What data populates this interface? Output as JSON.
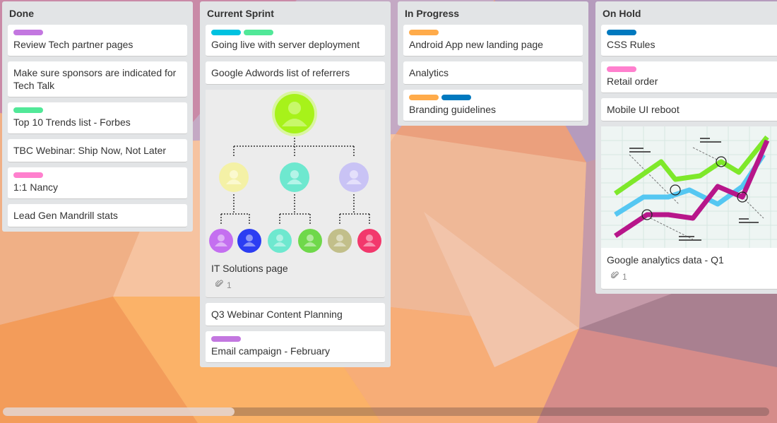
{
  "lists": [
    {
      "title": "Done",
      "cards": [
        {
          "title": "Review Tech partner pages",
          "labels": [
            "#c377e0"
          ]
        },
        {
          "title": "Make sure sponsors are indicated for Tech Talk",
          "labels": []
        },
        {
          "title": "Top 10 Trends list - Forbes",
          "labels": [
            "#51e898"
          ]
        },
        {
          "title": "TBC Webinar: Ship Now, Not Later",
          "labels": []
        },
        {
          "title": "1:1 Nancy",
          "labels": [
            "#ff80ce"
          ]
        },
        {
          "title": "Lead Gen Mandrill stats",
          "labels": []
        }
      ]
    },
    {
      "title": "Current Sprint",
      "cards": [
        {
          "title": "Going live with server deployment",
          "labels": [
            "#00c2e0",
            "#51e898"
          ]
        },
        {
          "title": "Google Adwords list of referrers",
          "labels": []
        },
        {
          "title": "IT Solutions page",
          "labels": [],
          "attachments": "1"
        },
        {
          "title": "Q3 Webinar Content Planning",
          "labels": []
        },
        {
          "title": "Email campaign - February",
          "labels": [
            "#c377e0"
          ]
        }
      ]
    },
    {
      "title": "In Progress",
      "cards": [
        {
          "title": "Android App new landing page",
          "labels": [
            "#ffab4a"
          ]
        },
        {
          "title": "Analytics",
          "labels": []
        },
        {
          "title": "Branding guidelines",
          "labels": [
            "#ffab4a",
            "#0079bf"
          ]
        }
      ]
    },
    {
      "title": "On Hold",
      "cards": [
        {
          "title": "CSS Rules",
          "labels": [
            "#0079bf"
          ]
        },
        {
          "title": "Retail order",
          "labels": [
            "#ff80ce"
          ]
        },
        {
          "title": "Mobile UI reboot",
          "labels": []
        },
        {
          "title": "Google analytics data - Q1",
          "labels": [],
          "attachments": "1"
        }
      ]
    }
  ],
  "icons": {
    "attachment": "paperclip-icon"
  }
}
